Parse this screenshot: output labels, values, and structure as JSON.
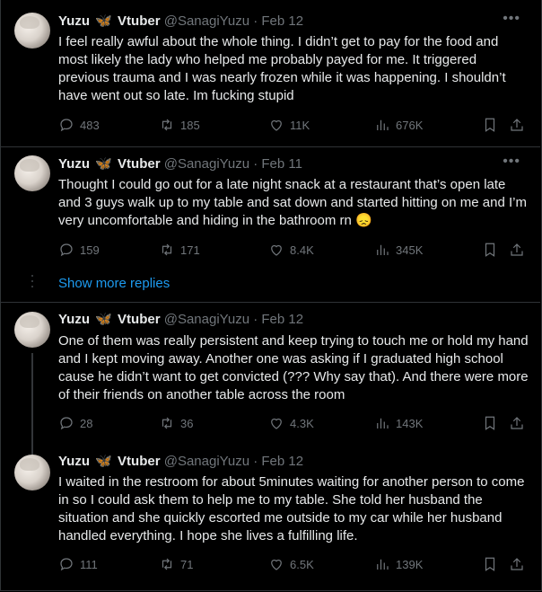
{
  "author": {
    "display_name": "Yuzu",
    "emoji_label": "Vtuber",
    "handle": "@SanagiYuzu"
  },
  "thread": {
    "show_more_replies": "Show more replies"
  },
  "tweets": [
    {
      "date": "Feb 12",
      "text": "I feel really awful about the whole thing. I didn’t get to pay for the food and most likely the lady who helped me probably payed for me. It triggered previous trauma and I was nearly frozen while it was happening. I shouldn’t have went out so late. Im fucking stupid",
      "replies": "483",
      "reposts": "185",
      "likes": "11K",
      "views": "676K"
    },
    {
      "date": "Feb 11",
      "text": "Thought I could go out for a late night snack at a restaurant that’s open late and 3 guys walk up to my table and sat down and started hitting on me and I’m very uncomfortable and hiding in the bathroom rn 😞",
      "replies": "159",
      "reposts": "171",
      "likes": "8.4K",
      "views": "345K"
    },
    {
      "date": "Feb 12",
      "text": "One of them was really persistent and keep trying to touch me or hold my hand and I kept moving away. Another one was asking if I graduated high school cause he didn’t want to get convicted (??? Why say that). And there were more of their friends on another table across the room",
      "replies": "28",
      "reposts": "36",
      "likes": "4.3K",
      "views": "143K"
    },
    {
      "date": "Feb 12",
      "text": "I waited in the restroom for about 5minutes waiting for another person to come in so I could ask them to help me to my table. She told her husband the situation and she quickly escorted me outside to my car while her husband handled everything. I hope she lives a fulfilling life.",
      "replies": "111",
      "reposts": "71",
      "likes": "6.5K",
      "views": "139K"
    }
  ],
  "colors": {
    "background": "#000000",
    "text": "#e7e9ea",
    "muted": "#71767b",
    "accent": "#1d9bf0",
    "divider": "#2f3336"
  },
  "icons": [
    "reply-icon",
    "repost-icon",
    "like-icon",
    "views-icon",
    "bookmark-icon",
    "share-icon",
    "more-icon",
    "butterfly-icon"
  ]
}
